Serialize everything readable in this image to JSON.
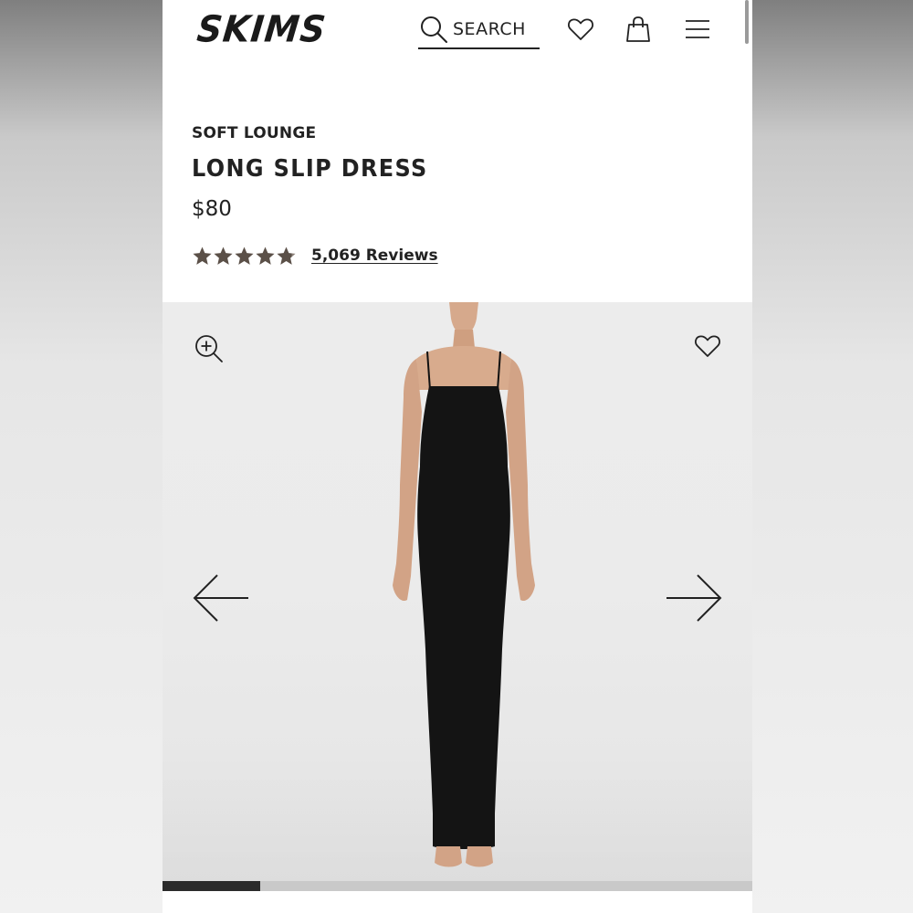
{
  "header": {
    "logo_text": "SKIMS",
    "search_label": "SEARCH"
  },
  "product": {
    "collection": "SOFT LOUNGE",
    "title": "LONG SLIP DRESS",
    "price": "$80",
    "rating": 4.8,
    "rating_max": 5,
    "reviews_label": "5,069 Reviews"
  },
  "gallery": {
    "progress_fraction": 0.165
  },
  "colors": {
    "text": "#222222",
    "star": "#5b5048",
    "dress": "#141414",
    "progress_active": "#2b2b2b",
    "progress_track": "#c9c9c9"
  },
  "icons": {
    "search": "search-icon",
    "wishlist": "heart-icon",
    "bag": "shopping-bag-icon",
    "menu": "hamburger-menu-icon",
    "zoom": "zoom-in-icon",
    "prev": "arrow-left-icon",
    "next": "arrow-right-icon"
  }
}
